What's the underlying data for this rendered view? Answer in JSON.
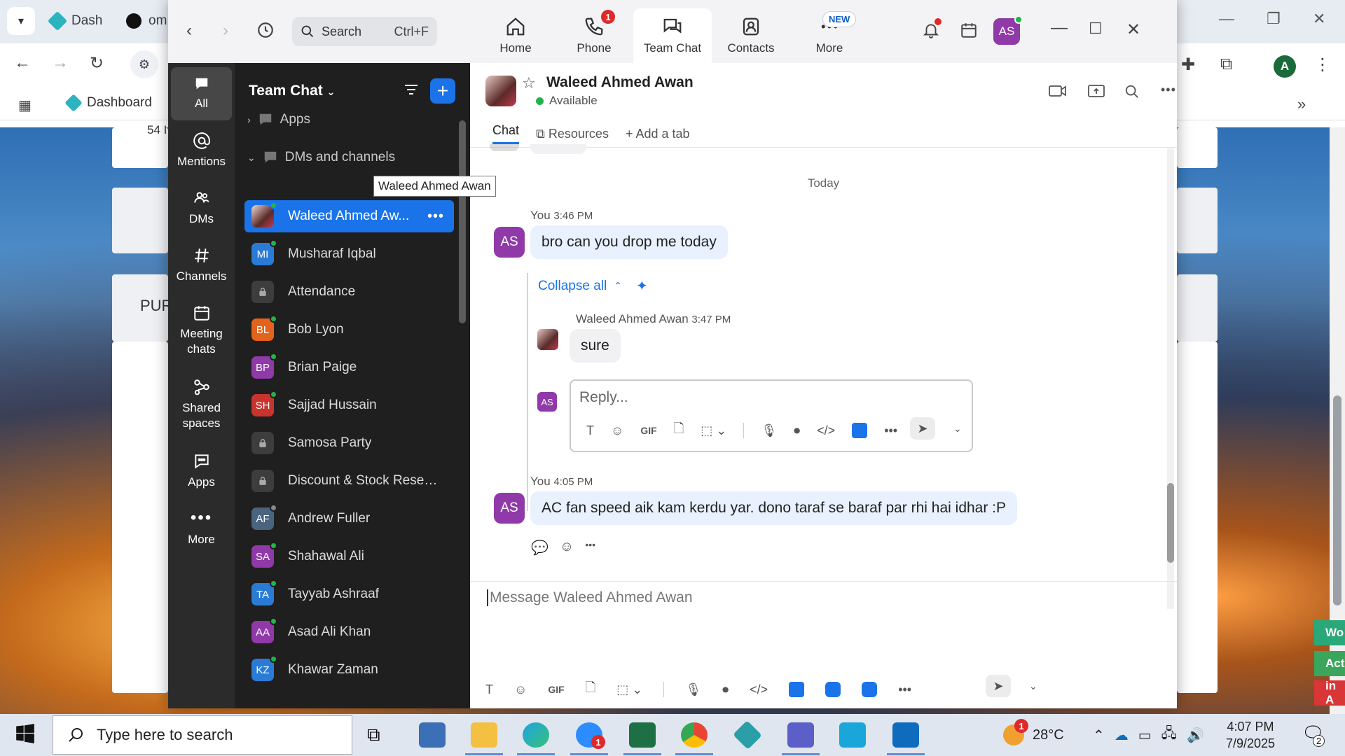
{
  "browser": {
    "tabs": [
      "Dash",
      "om"
    ],
    "bookmark": "Dashboard",
    "page_snippets": [
      "54 I",
      "PUR"
    ],
    "right_tags": [
      "Wo",
      "Act",
      "in A"
    ]
  },
  "zoom": {
    "search": {
      "placeholder": "Search",
      "shortcut": "Ctrl+F"
    },
    "tabs": [
      {
        "label": "Home"
      },
      {
        "label": "Phone",
        "badge": "1"
      },
      {
        "label": "Team Chat"
      },
      {
        "label": "Contacts"
      },
      {
        "label": "More",
        "badge": "NEW"
      }
    ],
    "avatar": "AS"
  },
  "rail": [
    {
      "label": "All"
    },
    {
      "label": "Mentions"
    },
    {
      "label": "DMs"
    },
    {
      "label": "Channels"
    },
    {
      "label": "Meeting chats"
    },
    {
      "label": "Shared spaces"
    },
    {
      "label": "Apps"
    },
    {
      "label": "More"
    }
  ],
  "chatlist": {
    "title": "Team Chat",
    "sections": {
      "apps": "Apps",
      "dms": "DMs and channels"
    },
    "items": [
      {
        "name": "Waleed Ahmed Aw...",
        "initials": "",
        "color": "#6b2a35"
      },
      {
        "name": "Musharaf Iqbal",
        "initials": "MI",
        "color": "#2a7bd6"
      },
      {
        "name": "Attendance",
        "initials": "",
        "color": "#3d3d3d"
      },
      {
        "name": "Bob Lyon",
        "initials": "BL",
        "color": "#e3621c"
      },
      {
        "name": "Brian Paige",
        "initials": "BP",
        "color": "#8f3aa8"
      },
      {
        "name": "Sajjad Hussain",
        "initials": "SH",
        "color": "#c9342f"
      },
      {
        "name": "Samosa Party",
        "initials": "",
        "color": "#3d3d3d"
      },
      {
        "name": "Discount & Stock Reser...",
        "initials": "",
        "color": "#3d3d3d"
      },
      {
        "name": "Andrew Fuller",
        "initials": "AF",
        "color": "#4a6480"
      },
      {
        "name": "Shahawal Ali",
        "initials": "SA",
        "color": "#8f3aa8"
      },
      {
        "name": "Tayyab Ashraaf",
        "initials": "TA",
        "color": "#2a7bd6"
      },
      {
        "name": "Asad Ali Khan",
        "initials": "AA",
        "color": "#8f3aa8"
      },
      {
        "name": "Khawar Zaman",
        "initials": "KZ",
        "color": "#2a7bd6"
      }
    ],
    "tooltip": "Waleed Ahmed Awan"
  },
  "chat": {
    "name": "Waleed Ahmed Awan",
    "status": "Available",
    "tabs": [
      "Chat",
      "Resources",
      "Add a tab"
    ],
    "day_label": "Today",
    "messages": [
      {
        "sender": "You",
        "time": "3:46 PM",
        "text": "bro can you drop me today",
        "avatar": "AS"
      },
      {
        "sender": "Waleed Ahmed Awan",
        "time": "3:47 PM",
        "text": "sure"
      },
      {
        "sender": "You",
        "time": "4:05 PM",
        "text": "AC fan speed aik kam kerdu yar. dono taraf se baraf par rhi hai idhar :P",
        "avatar": "AS"
      }
    ],
    "collapse_label": "Collapse all",
    "reply_placeholder": "Reply...",
    "reply_avatar": "AS",
    "compose_placeholder": "Message Waleed Ahmed Awan",
    "toolbar_gif": "GIF"
  },
  "taskbar": {
    "search_placeholder": "Type here to search",
    "zoom_badge": "1",
    "weather_badge": "1",
    "temperature": "28°C",
    "time": "4:07 PM",
    "date": "7/9/2025",
    "notif_count": "2"
  }
}
